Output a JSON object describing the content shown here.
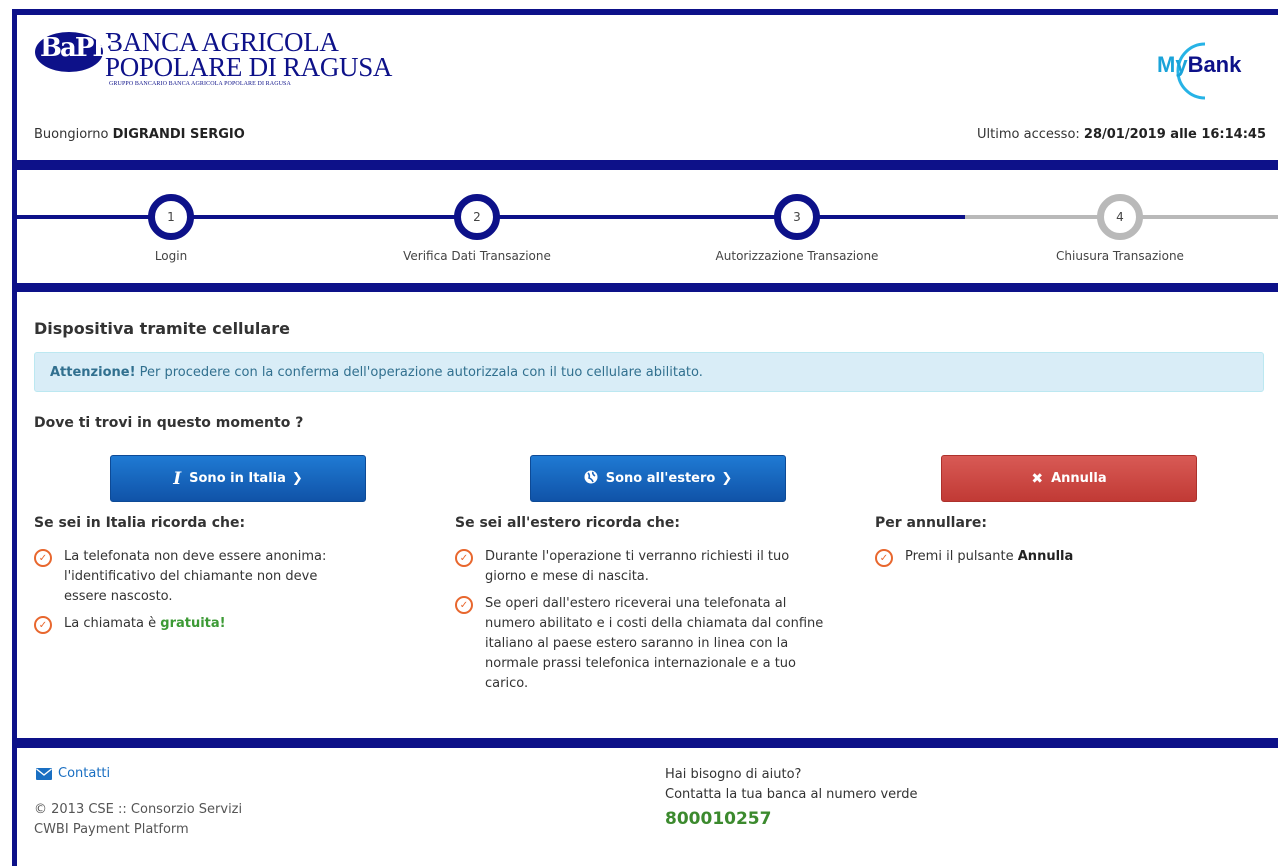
{
  "bank": {
    "logo_letters": "BaPR",
    "name_line1": "BANCA AGRICOLA",
    "name_line2": "POPOLARE DI RAGUSA",
    "name_line3": "GRUPPO BANCARIO BANCA AGRICOLA POPOLARE DI RAGUSA"
  },
  "mybank": {
    "my": "My",
    "bank": "Bank"
  },
  "header": {
    "greeting_prefix": "Buongiorno ",
    "user_name": "DIGRANDI SERGIO",
    "last_access_prefix": "Ultimo accesso: ",
    "last_access_value": "28/01/2019 alle 16:14:45"
  },
  "steps": [
    {
      "number": "1",
      "label": "Login",
      "active": true
    },
    {
      "number": "2",
      "label": "Verifica Dati Transazione",
      "active": true
    },
    {
      "number": "3",
      "label": "Autorizzazione Transazione",
      "active": true
    },
    {
      "number": "4",
      "label": "Chiusura Transazione",
      "active": false
    }
  ],
  "main": {
    "title": "Dispositiva tramite cellulare",
    "alert_strong": "Attenzione!",
    "alert_text": " Per procedere con la conferma dell'operazione autorizzala con il tuo cellulare abilitato.",
    "question": "Dove ti trovi in questo momento ?"
  },
  "buttons": {
    "italy": "Sono in Italia",
    "abroad": "Sono all'estero",
    "cancel": "Annulla"
  },
  "italy_col": {
    "title": "Se sei in Italia ricorda che:",
    "item1": "La telefonata non deve essere anonima: l'identificativo del chiamante non deve essere nascosto.",
    "item2_prefix": "La chiamata è ",
    "item2_strong": "gratuita!"
  },
  "abroad_col": {
    "title": "Se sei all'estero ricorda che:",
    "item1": "Durante l'operazione ti verranno richiesti il tuo giorno e mese di nascita.",
    "item2": "Se operi dall'estero riceverai una telefonata al numero abilitato e i costi della chiamata dal confine italiano al paese estero saranno in linea con la normale prassi telefonica internazionale e a tuo carico."
  },
  "cancel_col": {
    "title": "Per annullare:",
    "item1_prefix": "Premi il pulsante ",
    "item1_strong": "Annulla"
  },
  "footer": {
    "contacts": "Contatti",
    "copyright_line1": "© 2013 CSE :: Consorzio Servizi",
    "copyright_line2": "CWBI Payment Platform",
    "help_line1": "Hai bisogno di aiuto?",
    "help_line2": "Contatta la tua banca al numero verde",
    "phone": "800010257"
  },
  "colors": {
    "brand_blue": "#0d1189",
    "button_blue": "#1a63bb",
    "button_red": "#cc4a45",
    "check_orange": "#e8672e",
    "phone_green": "#3c8a2e"
  }
}
